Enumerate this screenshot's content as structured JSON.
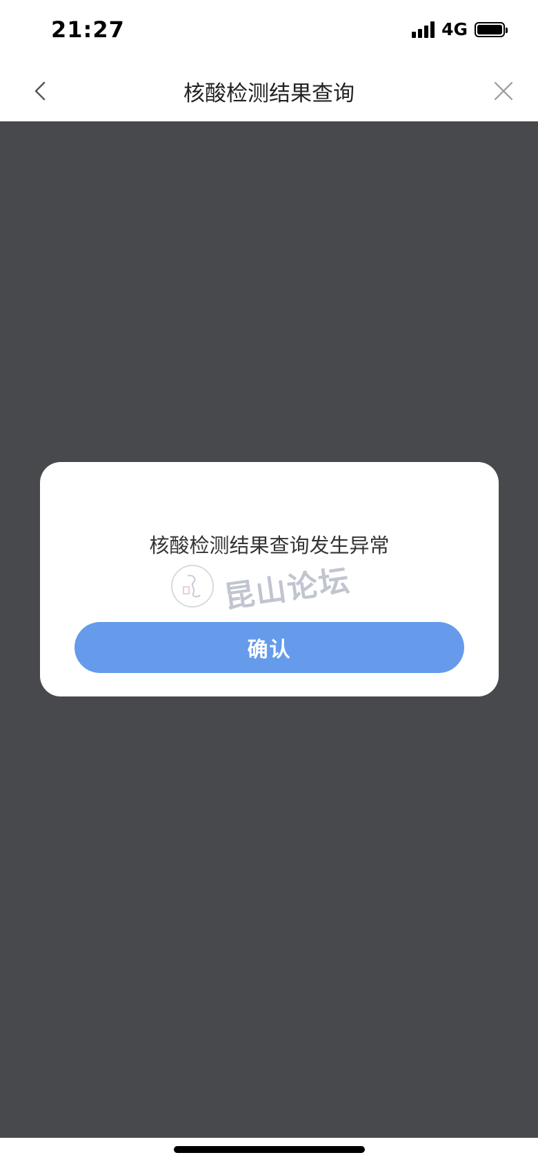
{
  "status_bar": {
    "time": "21:27",
    "network": "4G",
    "signal_bars": 4,
    "battery_level": 1.0
  },
  "nav": {
    "title": "核酸检测结果查询",
    "back_icon": "chevron-left-icon",
    "close_icon": "close-icon"
  },
  "dialog": {
    "message": "核酸检测结果查询发生异常",
    "confirm_label": "确认"
  },
  "watermark": {
    "text": "昆山论坛"
  },
  "colors": {
    "overlay": "#48494c",
    "button": "#659bea"
  }
}
